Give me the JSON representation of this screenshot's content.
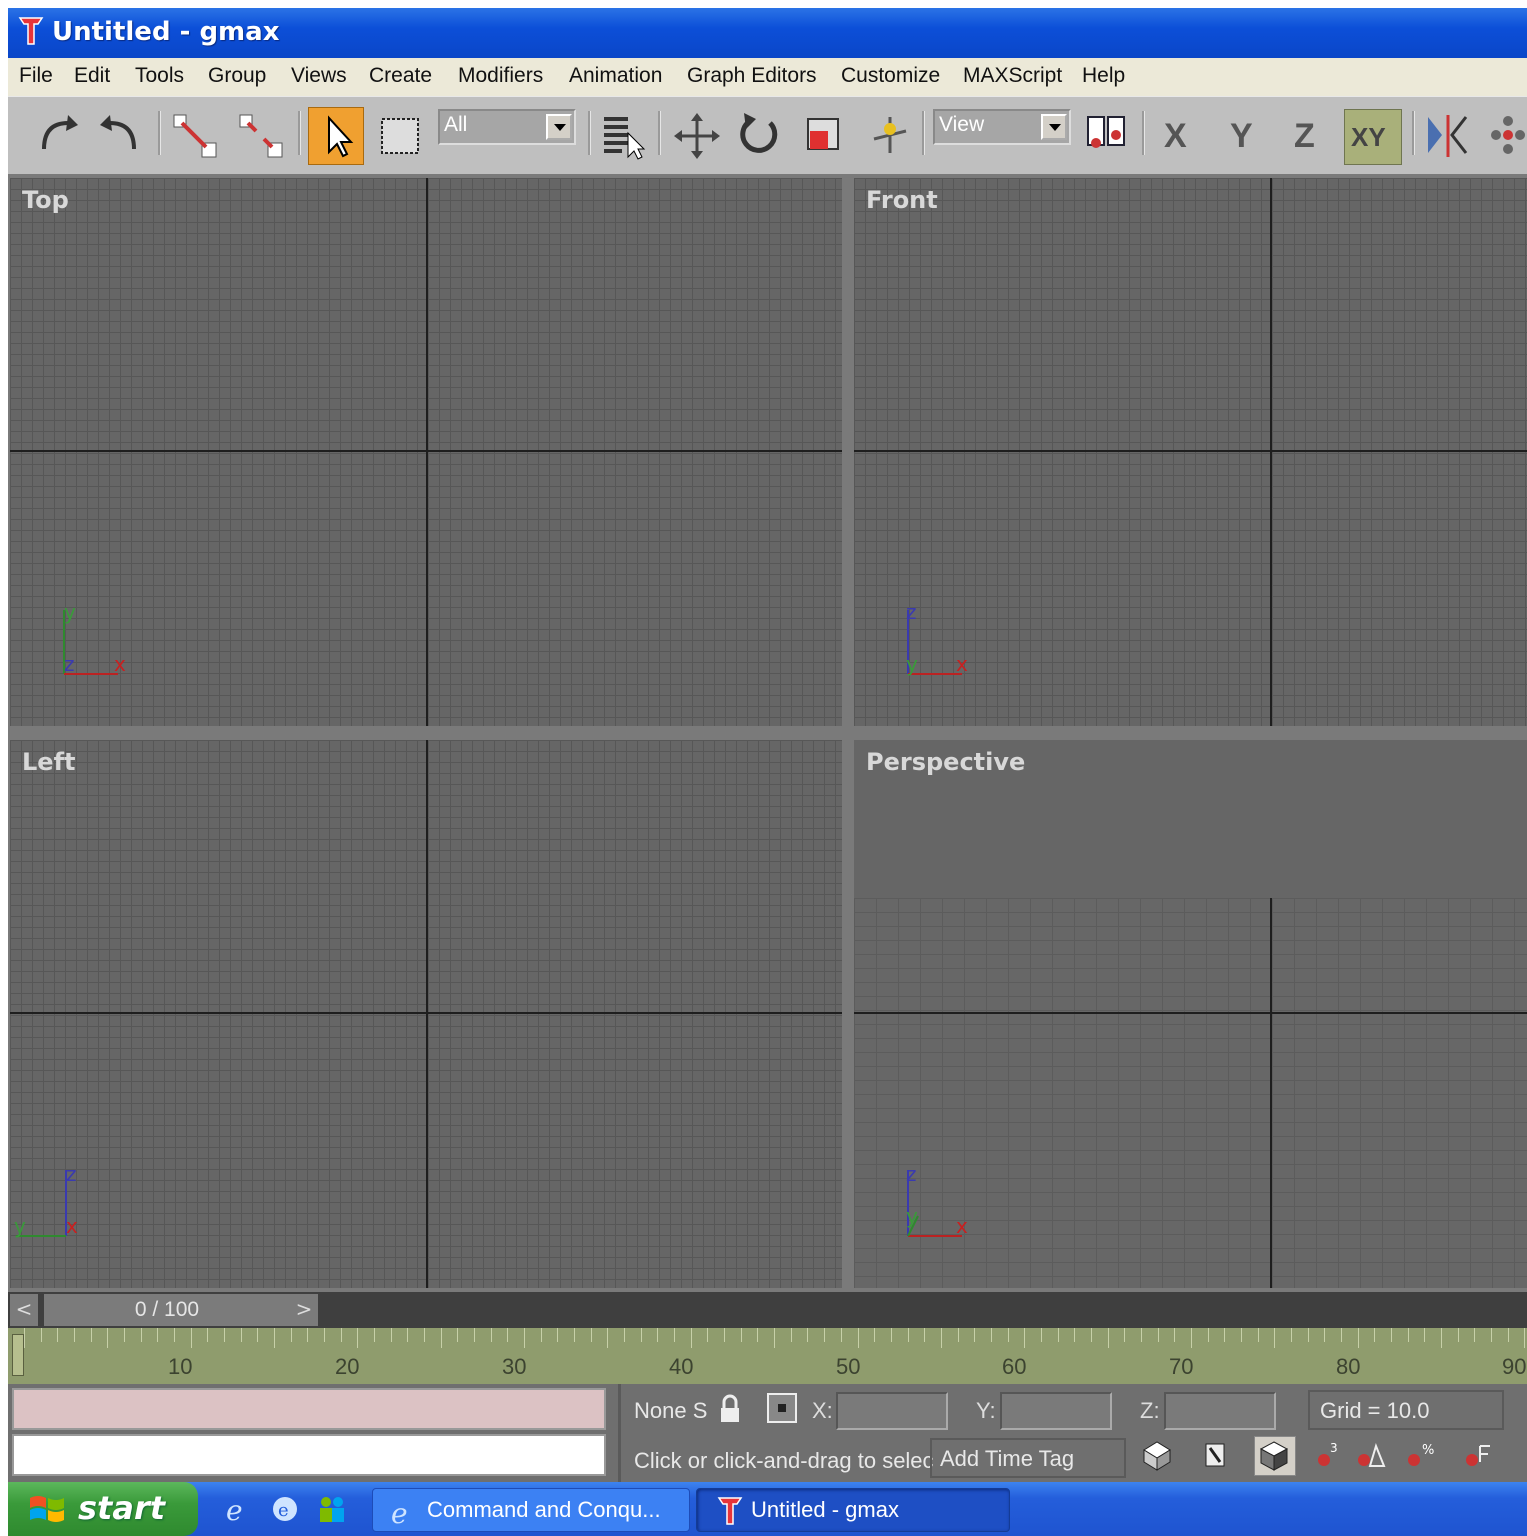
{
  "window": {
    "title": "Untitled - gmax"
  },
  "menu": [
    "File",
    "Edit",
    "Tools",
    "Group",
    "Views",
    "Create",
    "Modifiers",
    "Animation",
    "Graph Editors",
    "Customize",
    "MAXScript",
    "Help"
  ],
  "toolbar": {
    "selection_filter": "All",
    "reference_coord": "View",
    "axis_x": "X",
    "axis_y": "Y",
    "axis_z": "Z",
    "axis_xy": "XY"
  },
  "viewports": {
    "top": {
      "label": "Top",
      "axis_labels": [
        "y",
        "z",
        "x"
      ]
    },
    "front": {
      "label": "Front",
      "axis_labels": [
        "z",
        "y",
        "x"
      ]
    },
    "left": {
      "label": "Left",
      "axis_labels": [
        "z",
        "y",
        "x"
      ]
    },
    "perspective": {
      "label": "Perspective",
      "axis_labels": [
        "z",
        "y",
        "x"
      ]
    }
  },
  "timeline": {
    "prev": "<",
    "next": ">",
    "position": "0 / 100",
    "ticks": [
      "10",
      "20",
      "30",
      "40",
      "50",
      "60",
      "70",
      "80",
      "90"
    ]
  },
  "status": {
    "selection": "None S",
    "x_label": "X:",
    "y_label": "Y:",
    "z_label": "Z:",
    "grid": "Grid = 10.0",
    "prompt": "Click or click-and-drag to selec",
    "time_tag": "Add Time Tag"
  },
  "taskbar": {
    "start": "start",
    "tasks": [
      "Command and Conqu...",
      "Untitled - gmax"
    ]
  },
  "colors": {
    "title_blue": "#0c4fd8",
    "accent_orange": "#f0a030",
    "viewport_gray": "#666666",
    "track_green": "#8f9c6d"
  }
}
